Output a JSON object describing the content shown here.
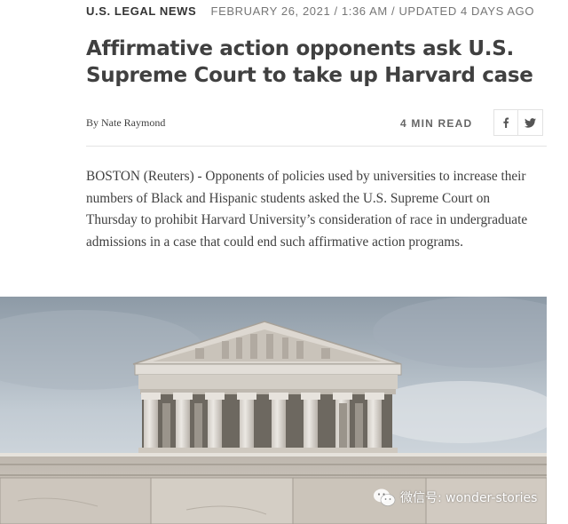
{
  "article": {
    "section": "U.S. LEGAL NEWS",
    "dateline": "FEBRUARY 26, 2021 / 1:36 AM / UPDATED 4 DAYS AGO",
    "headline": "Affirmative action opponents ask U.S. Supreme Court to take up Harvard case",
    "byline": "By Nate Raymond",
    "read_time": "4 MIN READ",
    "lede": "BOSTON (Reuters) - Opponents of policies used by universities to increase their numbers of Black and Hispanic students asked the U.S. Supreme Court on Thursday to prohibit Harvard University’s consideration of race in undergraduate admissions in a case that could end such affirmative action programs."
  },
  "share": {
    "facebook_icon": "facebook-icon",
    "twitter_icon": "twitter-icon"
  },
  "photo": {
    "subject": "supreme-court-building-photo"
  },
  "watermark": {
    "text": "微信号: wonder-stories",
    "icon": "wechat-icon"
  },
  "colors": {
    "text": "#404040",
    "muted": "#767676",
    "divider": "#e4e4e4"
  }
}
